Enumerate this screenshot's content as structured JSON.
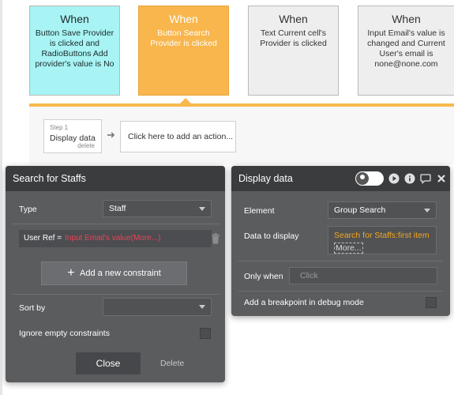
{
  "events": [
    {
      "when": "When",
      "description": "Button Save Provider is clicked and RadioButtons Add provider's value is No"
    },
    {
      "when": "When",
      "description": "Button Search Provider is clicked"
    },
    {
      "when": "When",
      "description": "Text Current cell's Provider is clicked"
    },
    {
      "when": "When",
      "description": "Input Email's value is changed and Current User's email is none@none.com"
    }
  ],
  "workflow": {
    "step_number": "Step 1",
    "step_title": "Display data",
    "step_delete": "delete",
    "add_action": "Click here to add an action..."
  },
  "search_panel": {
    "title": "Search for Staffs",
    "type_label": "Type",
    "type_value": "Staff",
    "constraint_label": "User Ref =",
    "constraint_value": "Input Email's value(More...)",
    "add_constraint_label": "Add a new constraint",
    "sort_by_label": "Sort by",
    "sort_by_value": "",
    "ignore_empty_label": "Ignore empty constraints",
    "close_label": "Close",
    "delete_label": "Delete"
  },
  "display_panel": {
    "title": "Display data",
    "element_label": "Element",
    "element_value": "Group Search",
    "data_label": "Data to display",
    "data_value": "Search for Staffs:first item",
    "data_more": "More...",
    "only_when_label": "Only when",
    "only_when_placeholder": "Click",
    "breakpoint_label": "Add a breakpoint in debug mode"
  },
  "colors": {
    "event_active": "#f8b64c",
    "event_cyan": "#a8f3f3",
    "panel_bg": "#5a5c5e",
    "panel_header": "#3a3c3e",
    "accent_orange": "#f5a623",
    "constraint_red": "#e8445a"
  },
  "icons": [
    "arrow-right-icon",
    "plus-icon",
    "trash-icon",
    "caret-down-icon",
    "user-icon",
    "play-icon",
    "info-icon",
    "comment-icon",
    "close-icon"
  ]
}
